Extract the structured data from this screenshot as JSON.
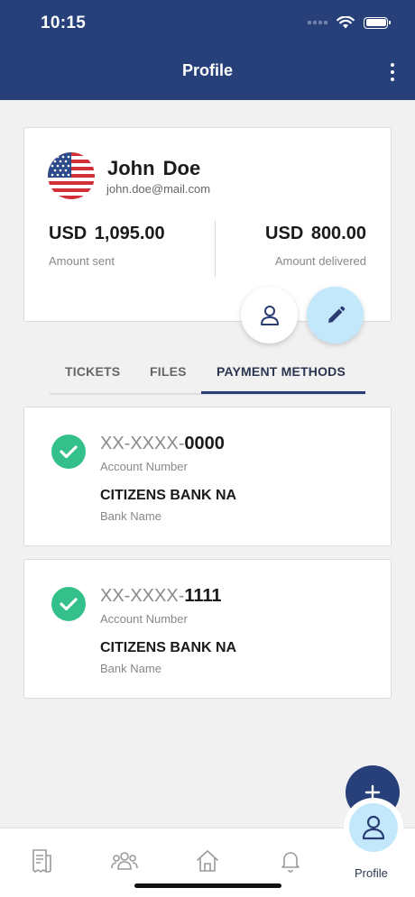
{
  "status_bar": {
    "time": "10:15"
  },
  "header": {
    "title": "Profile"
  },
  "profile": {
    "name": "John  Doe",
    "email": "john.doe@mail.com",
    "amount_sent": "USD  1,095.00",
    "amount_sent_label": "Amount sent",
    "amount_delivered": "USD  800.00",
    "amount_delivered_label": "Amount delivered"
  },
  "tabs": [
    {
      "label": "TICKETS",
      "active": false
    },
    {
      "label": "FILES",
      "active": false
    },
    {
      "label": "PAYMENT METHODS",
      "active": true
    }
  ],
  "payment_methods": [
    {
      "account_mask": "XX-XXXX-",
      "account_last": "0000",
      "account_label": "Account Number",
      "bank_name": "CITIZENS BANK NA",
      "bank_label": "Bank Name"
    },
    {
      "account_mask": "XX-XXXX-",
      "account_last": "1111",
      "account_label": "Account Number",
      "bank_name": "CITIZENS BANK NA",
      "bank_label": "Bank Name"
    }
  ],
  "bottom_nav": {
    "items": [
      "receipt-icon",
      "users-icon",
      "home-icon",
      "bell-icon",
      "profile-icon"
    ],
    "active_label": "Profile"
  },
  "colors": {
    "primary": "#27407a",
    "accent_light": "#c3e8fb",
    "success": "#33c08a"
  }
}
